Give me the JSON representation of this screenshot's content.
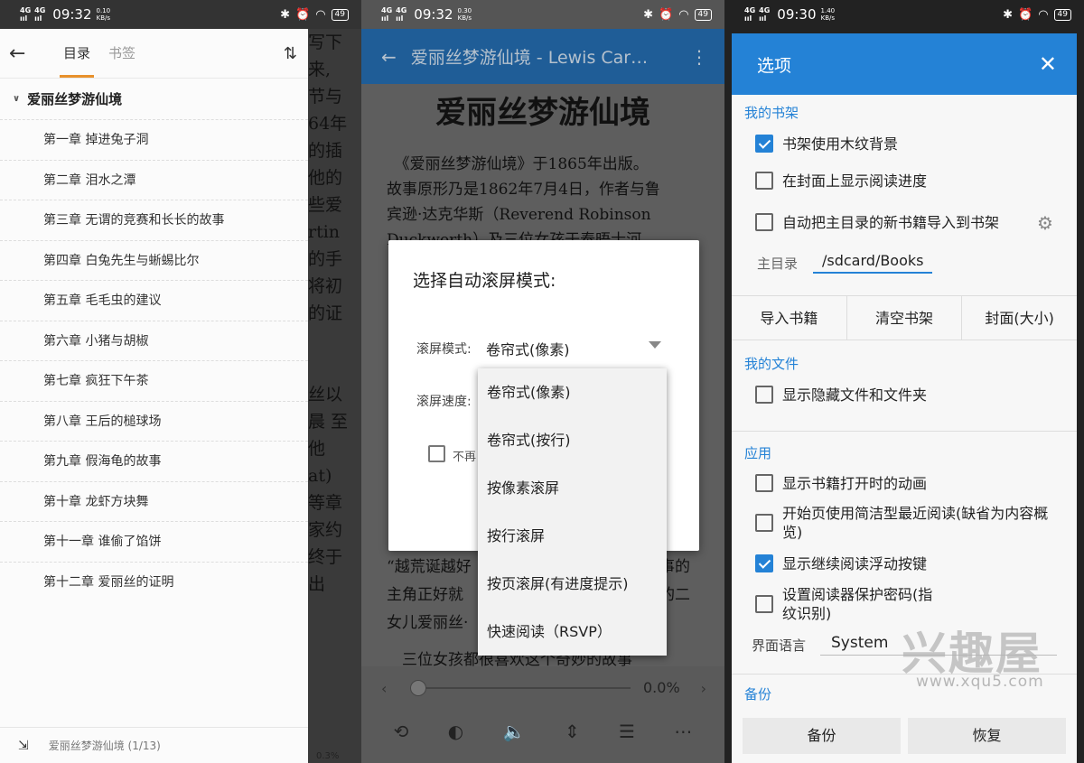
{
  "panel1": {
    "status": {
      "network": "4G HD",
      "time": "09:32",
      "speed_top": "0.10",
      "speed_unit": "KB/s",
      "battery": "49"
    },
    "tabs": [
      {
        "label": "目录"
      },
      {
        "label": "书签"
      }
    ],
    "sort_icon": "sort-icon",
    "book_title": "爱丽丝梦游仙境",
    "chapters": [
      "第一章 掉进兔子洞",
      "第二章 泪水之潭",
      "第三章 无谓的竞赛和长长的故事",
      "第四章 白兔先生与蜥蜴比尔",
      "第五章 毛毛虫的建议",
      "第六章 小猪与胡椒",
      "第七章 疯狂下午茶",
      "第八章 王后的槌球场",
      "第九章 假海龟的故事",
      "第十章 龙虾方块舞",
      "第十一章 谁偷了馅饼",
      "第十二章 爱丽丝的证明"
    ],
    "footer_text": "爱丽丝梦游仙境 (1/13)",
    "bg_lines": [
      "写下",
      "来,",
      "节与",
      "64年",
      "的插",
      "他的",
      "些爱",
      "rtin",
      "的手",
      "将初",
      "的证",
      "",
      "",
      "丝以",
      "晨 至",
      "他",
      "at)",
      "等章",
      "家约",
      "终于",
      "出"
    ],
    "bg_percent": "0.3%"
  },
  "panel2": {
    "status": {
      "network": "4G HD",
      "time": "09:32",
      "speed_top": "0.30",
      "speed_unit": "KB/s",
      "battery": "49"
    },
    "toolbar_title": "爱丽丝梦游仙境 - Lewis Car…",
    "page_title": "爱丽丝梦游仙境",
    "paragraph_lines": [
      "　《爱丽丝梦游仙境》于1865年出版。",
      "故事原形乃是1862年7月4日，作者与鲁",
      "宾逊·达克华斯（Reverend Robinson",
      "Duckworth）及三位女孩于泰晤士河"
    ],
    "lower_lines": [
      "“越荒诞越好",
      "主角正好就",
      "女儿爱丽丝·",
      "　三位女孩都很喜欢这个奇妙的故事"
    ],
    "lower_right": [
      "事的",
      "的二"
    ],
    "dialog": {
      "title": "选择自动滚屏模式:",
      "mode_label": "滚屏模式:",
      "mode_value": "卷帘式(像素)",
      "speed_label": "滚屏速度:",
      "checkbox_label": "不再"
    },
    "dropdown_options": [
      "卷帘式(像素)",
      "卷帘式(按行)",
      "按像素滚屏",
      "按行滚屏",
      "按页滚屏(有进度提示)",
      "快速阅读（RSVP）"
    ],
    "progress": "0.0%",
    "progress_value": 0
  },
  "panel3": {
    "status": {
      "network": "4G HD",
      "time": "09:30",
      "speed_top": "1.40",
      "speed_unit": "KB/s",
      "battery": "49"
    },
    "header_title": "选项",
    "sections": {
      "shelf": "我的书架",
      "files": "我的文件",
      "app": "应用",
      "backup": "备份"
    },
    "shelf_items": [
      {
        "label": "书架使用木纹背景",
        "checked": true
      },
      {
        "label": "在封面上显示阅读进度",
        "checked": false
      },
      {
        "label": "自动把主目录的新书籍导入到书架",
        "checked": false
      }
    ],
    "home_label": "主目录",
    "home_value": "/sdcard/Books",
    "buttons": [
      "导入书籍",
      "清空书架",
      "封面(大小)"
    ],
    "file_items": [
      {
        "label": "显示隐藏文件和文件夹",
        "checked": false
      }
    ],
    "app_items": [
      {
        "label": "显示书籍打开时的动画",
        "checked": false
      },
      {
        "label": "开始页使用简洁型最近阅读(缺省为内容概览)",
        "checked": false
      },
      {
        "label": "显示继续阅读浮动按键",
        "checked": true
      },
      {
        "label": "设置阅读器保护密码(指纹识别)",
        "checked": false
      }
    ],
    "lang_label": "界面语言",
    "lang_value": "System",
    "backup_buttons": [
      "备份",
      "恢复"
    ]
  },
  "watermark": {
    "brand": "兴趣屋",
    "url": "www.xqu5.com"
  },
  "colors": {
    "accent_orange": "#e8912c",
    "blue": "#2482d6",
    "toolbar_blue": "#1f5d97"
  }
}
